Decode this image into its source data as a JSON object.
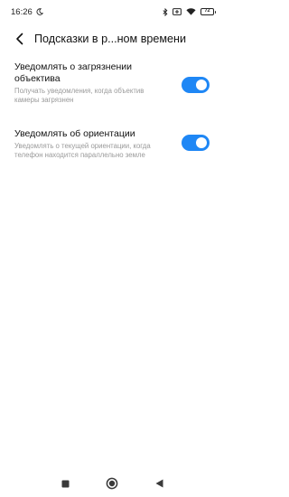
{
  "status_bar": {
    "time": "16:26",
    "battery": "72",
    "icons": [
      "moon-icon",
      "bluetooth-icon",
      "battery-saver-icon",
      "wifi-icon",
      "battery-icon"
    ]
  },
  "header": {
    "title": "Подсказки в р...ном времени",
    "back_icon": "chevron-left-icon"
  },
  "settings": [
    {
      "title": "Уведомлять о загрязнении объектива",
      "description": "Получать уведомления, когда объектив камеры загрязнен",
      "enabled": true
    },
    {
      "title": "Уведомлять об ориентации",
      "description": "Уведомлять о текущей ориентации, когда телефон находится параллельно земле",
      "enabled": true
    }
  ],
  "colors": {
    "accent": "#1f87f5",
    "secondary_text": "#9a9a9a",
    "background": "#ffffff"
  },
  "nav_bar": {
    "icons": [
      "recent-apps-icon",
      "home-icon",
      "back-icon"
    ]
  }
}
